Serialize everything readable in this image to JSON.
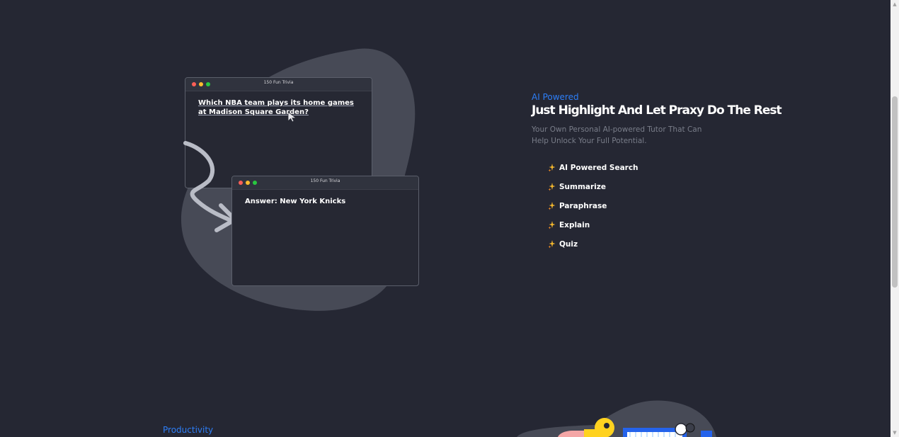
{
  "illustration": {
    "window1": {
      "title": "150 Fun Trivia",
      "question": "Which NBA team plays its home games at Madison Square Garden?"
    },
    "window2": {
      "title": "150 Fun Trivia",
      "answer": "Answer: New York Knicks"
    }
  },
  "feature": {
    "eyebrow": "AI Powered",
    "headline": "Just Highlight And Let Praxy Do The Rest",
    "description": "Your Own Personal AI-powered Tutor That Can Help Unlock Your Full Potential.",
    "items": [
      {
        "label": "AI Powered Search",
        "icon": "sparkle-icon"
      },
      {
        "label": "Summarize",
        "icon": "sparkle-icon"
      },
      {
        "label": "Paraphrase",
        "icon": "sparkle-icon"
      },
      {
        "label": "Explain",
        "icon": "sparkle-icon"
      },
      {
        "label": "Quiz",
        "icon": "sparkle-icon"
      }
    ]
  },
  "next_section": {
    "eyebrow": "Productivity"
  },
  "colors": {
    "background": "#252733",
    "accent": "#2d7ef7",
    "sparkle_yellow": "#f5b82e",
    "sparkle_orange": "#f08a24"
  }
}
